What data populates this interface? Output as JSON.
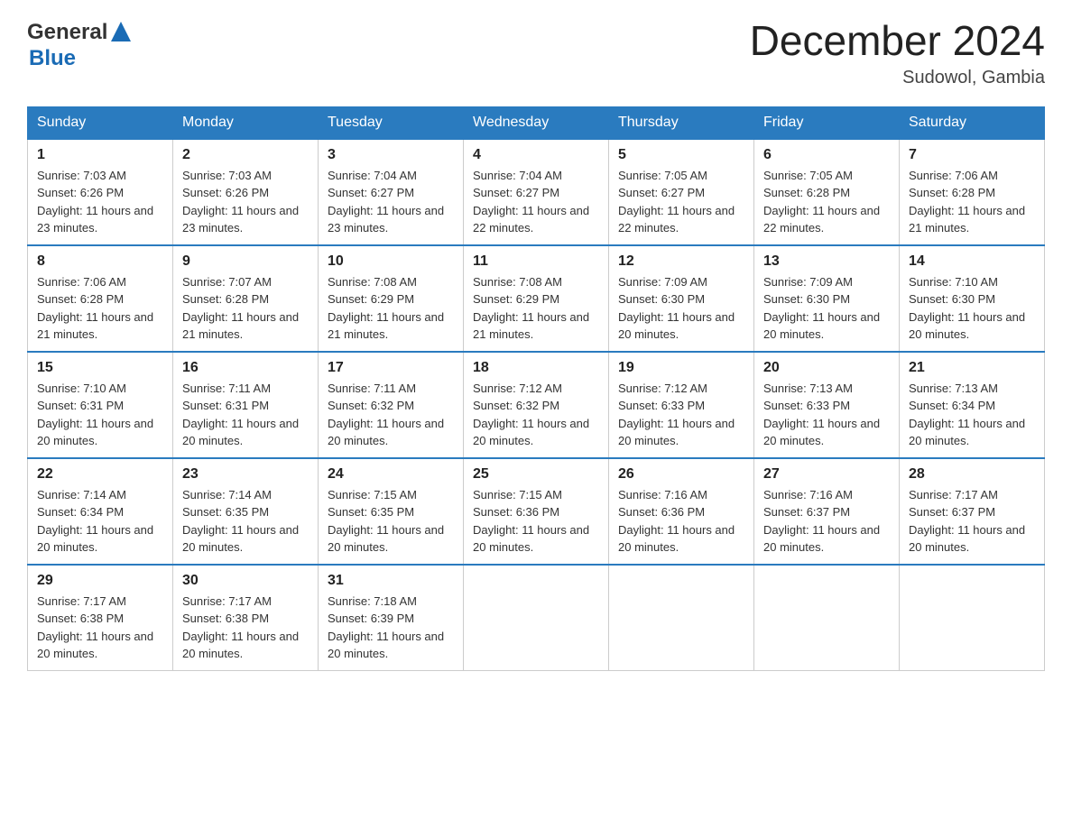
{
  "logo": {
    "text_general": "General",
    "text_blue": "Blue"
  },
  "header": {
    "month_year": "December 2024",
    "location": "Sudowol, Gambia"
  },
  "days_of_week": [
    "Sunday",
    "Monday",
    "Tuesday",
    "Wednesday",
    "Thursday",
    "Friday",
    "Saturday"
  ],
  "weeks": [
    [
      {
        "day": 1,
        "sunrise": "7:03 AM",
        "sunset": "6:26 PM",
        "daylight": "11 hours and 23 minutes."
      },
      {
        "day": 2,
        "sunrise": "7:03 AM",
        "sunset": "6:26 PM",
        "daylight": "11 hours and 23 minutes."
      },
      {
        "day": 3,
        "sunrise": "7:04 AM",
        "sunset": "6:27 PM",
        "daylight": "11 hours and 23 minutes."
      },
      {
        "day": 4,
        "sunrise": "7:04 AM",
        "sunset": "6:27 PM",
        "daylight": "11 hours and 22 minutes."
      },
      {
        "day": 5,
        "sunrise": "7:05 AM",
        "sunset": "6:27 PM",
        "daylight": "11 hours and 22 minutes."
      },
      {
        "day": 6,
        "sunrise": "7:05 AM",
        "sunset": "6:28 PM",
        "daylight": "11 hours and 22 minutes."
      },
      {
        "day": 7,
        "sunrise": "7:06 AM",
        "sunset": "6:28 PM",
        "daylight": "11 hours and 21 minutes."
      }
    ],
    [
      {
        "day": 8,
        "sunrise": "7:06 AM",
        "sunset": "6:28 PM",
        "daylight": "11 hours and 21 minutes."
      },
      {
        "day": 9,
        "sunrise": "7:07 AM",
        "sunset": "6:28 PM",
        "daylight": "11 hours and 21 minutes."
      },
      {
        "day": 10,
        "sunrise": "7:08 AM",
        "sunset": "6:29 PM",
        "daylight": "11 hours and 21 minutes."
      },
      {
        "day": 11,
        "sunrise": "7:08 AM",
        "sunset": "6:29 PM",
        "daylight": "11 hours and 21 minutes."
      },
      {
        "day": 12,
        "sunrise": "7:09 AM",
        "sunset": "6:30 PM",
        "daylight": "11 hours and 20 minutes."
      },
      {
        "day": 13,
        "sunrise": "7:09 AM",
        "sunset": "6:30 PM",
        "daylight": "11 hours and 20 minutes."
      },
      {
        "day": 14,
        "sunrise": "7:10 AM",
        "sunset": "6:30 PM",
        "daylight": "11 hours and 20 minutes."
      }
    ],
    [
      {
        "day": 15,
        "sunrise": "7:10 AM",
        "sunset": "6:31 PM",
        "daylight": "11 hours and 20 minutes."
      },
      {
        "day": 16,
        "sunrise": "7:11 AM",
        "sunset": "6:31 PM",
        "daylight": "11 hours and 20 minutes."
      },
      {
        "day": 17,
        "sunrise": "7:11 AM",
        "sunset": "6:32 PM",
        "daylight": "11 hours and 20 minutes."
      },
      {
        "day": 18,
        "sunrise": "7:12 AM",
        "sunset": "6:32 PM",
        "daylight": "11 hours and 20 minutes."
      },
      {
        "day": 19,
        "sunrise": "7:12 AM",
        "sunset": "6:33 PM",
        "daylight": "11 hours and 20 minutes."
      },
      {
        "day": 20,
        "sunrise": "7:13 AM",
        "sunset": "6:33 PM",
        "daylight": "11 hours and 20 minutes."
      },
      {
        "day": 21,
        "sunrise": "7:13 AM",
        "sunset": "6:34 PM",
        "daylight": "11 hours and 20 minutes."
      }
    ],
    [
      {
        "day": 22,
        "sunrise": "7:14 AM",
        "sunset": "6:34 PM",
        "daylight": "11 hours and 20 minutes."
      },
      {
        "day": 23,
        "sunrise": "7:14 AM",
        "sunset": "6:35 PM",
        "daylight": "11 hours and 20 minutes."
      },
      {
        "day": 24,
        "sunrise": "7:15 AM",
        "sunset": "6:35 PM",
        "daylight": "11 hours and 20 minutes."
      },
      {
        "day": 25,
        "sunrise": "7:15 AM",
        "sunset": "6:36 PM",
        "daylight": "11 hours and 20 minutes."
      },
      {
        "day": 26,
        "sunrise": "7:16 AM",
        "sunset": "6:36 PM",
        "daylight": "11 hours and 20 minutes."
      },
      {
        "day": 27,
        "sunrise": "7:16 AM",
        "sunset": "6:37 PM",
        "daylight": "11 hours and 20 minutes."
      },
      {
        "day": 28,
        "sunrise": "7:17 AM",
        "sunset": "6:37 PM",
        "daylight": "11 hours and 20 minutes."
      }
    ],
    [
      {
        "day": 29,
        "sunrise": "7:17 AM",
        "sunset": "6:38 PM",
        "daylight": "11 hours and 20 minutes."
      },
      {
        "day": 30,
        "sunrise": "7:17 AM",
        "sunset": "6:38 PM",
        "daylight": "11 hours and 20 minutes."
      },
      {
        "day": 31,
        "sunrise": "7:18 AM",
        "sunset": "6:39 PM",
        "daylight": "11 hours and 20 minutes."
      },
      null,
      null,
      null,
      null
    ]
  ]
}
